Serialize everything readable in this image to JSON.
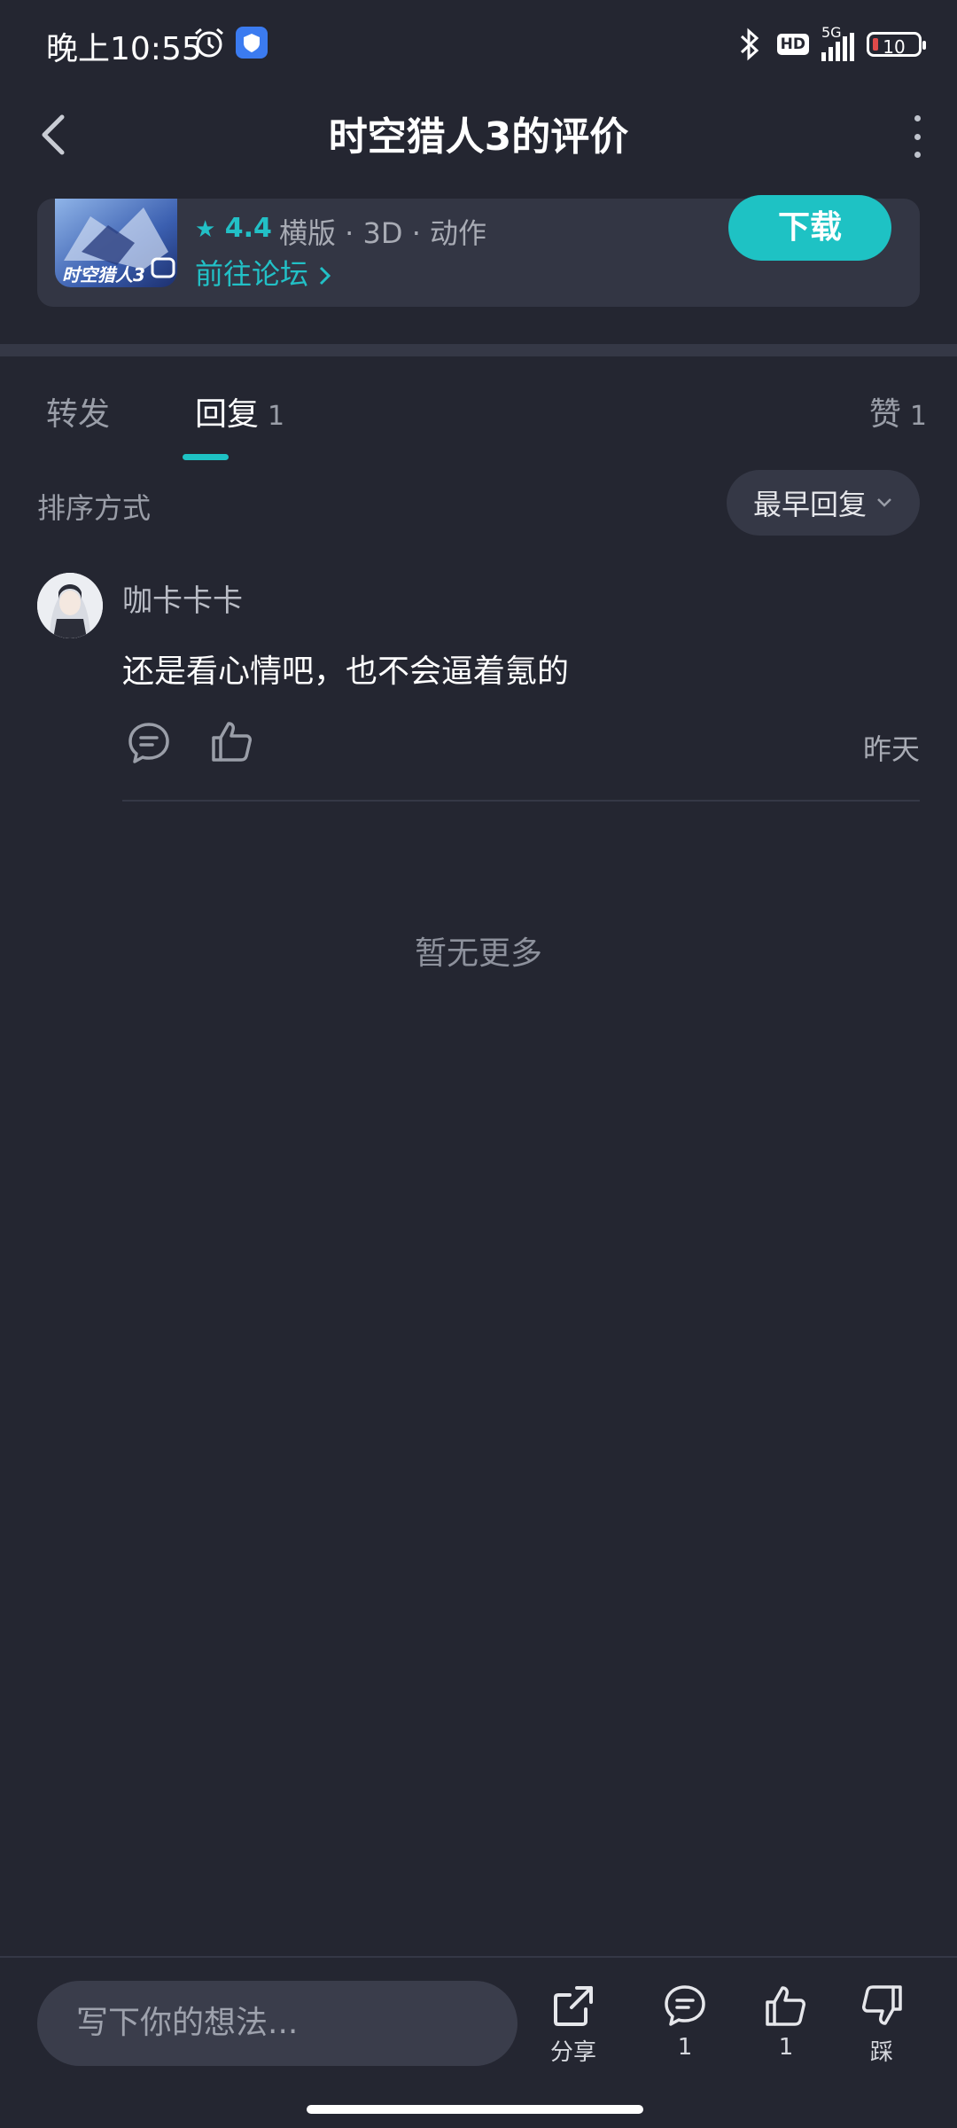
{
  "status_bar": {
    "time": "晚上10:55",
    "network": "5G",
    "hd": "HD",
    "battery": "10"
  },
  "header": {
    "title": "时空猎人3的评价"
  },
  "game": {
    "icon_text": "时空猎人3",
    "rating": "4.4",
    "tags": "横版 · 3D · 动作",
    "forum_link": "前往论坛",
    "download": "下载"
  },
  "tabs": [
    {
      "label": "转发",
      "count": ""
    },
    {
      "label": "回复",
      "count": "1"
    },
    {
      "label": "赞",
      "count": "1"
    }
  ],
  "sort": {
    "label": "排序方式",
    "selected": "最早回复"
  },
  "comments": [
    {
      "user": "咖卡卡卡",
      "text": "还是看心情吧，也不会逼着氪的",
      "time": "昨天"
    }
  ],
  "no_more": "暂无更多",
  "bottom_bar": {
    "placeholder": "写下你的想法...",
    "share_label": "分享",
    "comment_count": "1",
    "like_count": "1",
    "dislike_label": "踩"
  },
  "colors": {
    "background": "#242631",
    "accent": "#1ec2c4",
    "card": "#333644"
  }
}
